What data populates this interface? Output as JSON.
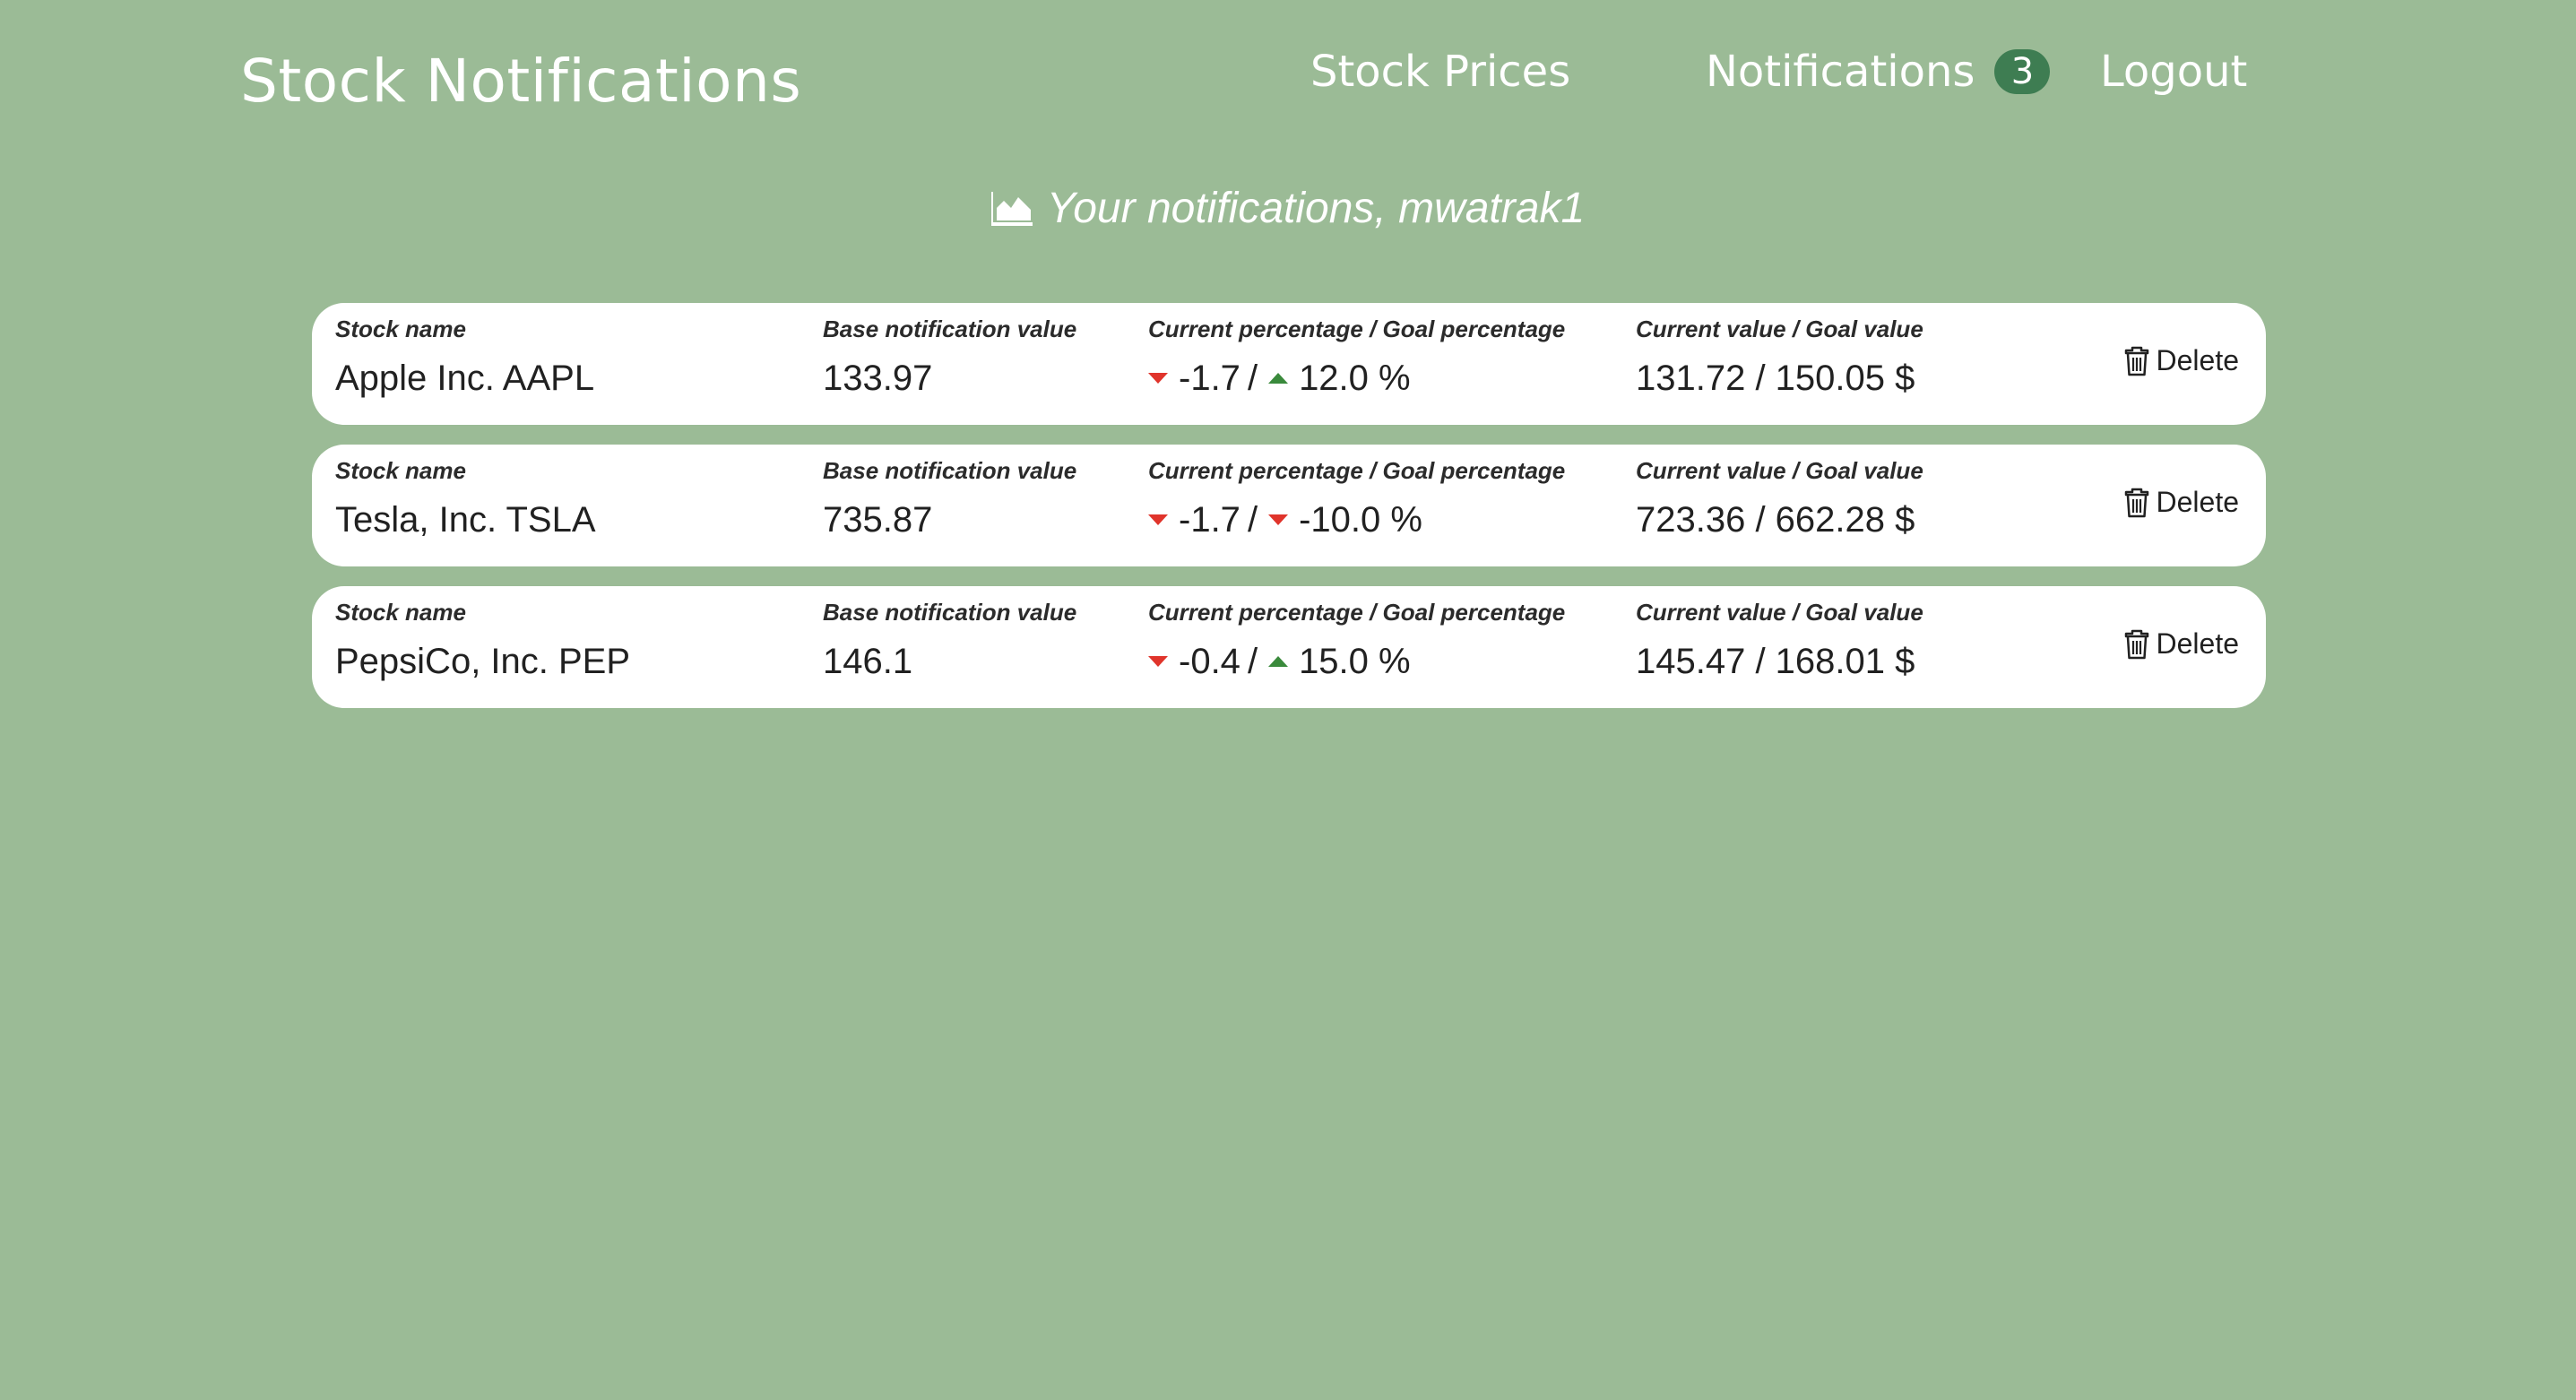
{
  "header": {
    "brand": "Stock Notifications",
    "nav": {
      "stock_prices": "Stock Prices",
      "notifications": "Notifications",
      "notifications_count": "3",
      "logout": "Logout"
    }
  },
  "page": {
    "subtitle_icon": "area-chart-icon",
    "subtitle": "Your notifications, mwatrak1"
  },
  "columns": {
    "stock_name": "Stock name",
    "base_value": "Base notification value",
    "percentage": "Current percentage / Goal percentage",
    "value": "Current value / Goal value"
  },
  "delete_label": "Delete",
  "delete_icon": "trash-icon",
  "colors": {
    "background": "#9bbb96",
    "badge": "#3e7d52",
    "down": "#e0342b",
    "up": "#3a8a3c"
  },
  "notifications": [
    {
      "stock_name": "Apple Inc. AAPL",
      "base_value": "133.97",
      "current_pct": "-1.7",
      "current_dir": "down",
      "goal_pct": "12.0 %",
      "goal_dir": "up",
      "values": "131.72 / 150.05 $"
    },
    {
      "stock_name": "Tesla, Inc. TSLA",
      "base_value": "735.87",
      "current_pct": "-1.7",
      "current_dir": "down",
      "goal_pct": "-10.0 %",
      "goal_dir": "down",
      "values": "723.36 / 662.28 $"
    },
    {
      "stock_name": "PepsiCo, Inc. PEP",
      "base_value": "146.1",
      "current_pct": "-0.4",
      "current_dir": "down",
      "goal_pct": "15.0 %",
      "goal_dir": "up",
      "values": "145.47 / 168.01 $"
    }
  ]
}
